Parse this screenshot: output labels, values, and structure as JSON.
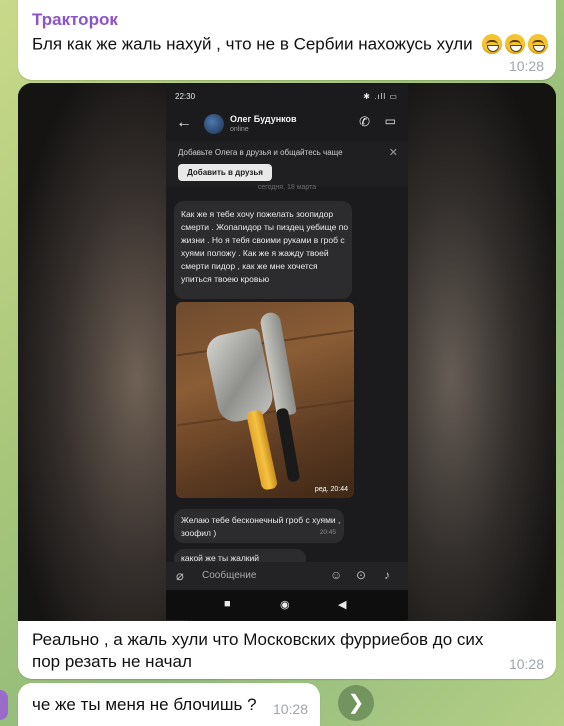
{
  "messages": [
    {
      "sender": "Тракторок",
      "text": "Бля как же жаль нахуй , что не в Сербии нахожусь хули",
      "emojis": [
        "grinning-face",
        "grinning-face",
        "grinning-face"
      ],
      "time": "10:28"
    },
    {
      "type": "screenshot",
      "phone": {
        "status_time": "22:30",
        "status_icons": "✱ .ıll ▭",
        "contact_name": "Олег Будунков",
        "contact_status": "online",
        "banner_text": "Добавьте Олега в друзья и общайтесь чаще",
        "banner_button": "Добавить в друзья",
        "date_divider": "сегодня, 18 марта",
        "bubble1": "Как же я тебе хочу пожелать зоопидор смерти . Жопапидор ты пиздец уебище по жизни . Но я тебя своими руками в гроб с хуями положу . Как же я жажду твоей смерти пидор , как же мне хочется упиться твоею кровью",
        "photo_time": "ред. 20:44",
        "bubble3": "Желаю тебе бесконечный гроб с хуями , зоофил )",
        "bubble3_time": "20:45",
        "bubble4_partial": "какой же ты жалкий",
        "input_placeholder": "Сообщение"
      }
    },
    {
      "text": "Реально , а жаль хули что Московских фурриебов до сих пор резать не начал",
      "time": "10:28"
    },
    {
      "text": "че же ты меня не блочишь ?",
      "time": "10:28"
    }
  ],
  "colors": {
    "sender": "#8b54c9",
    "bubble": "#ffffff",
    "time": "#a0a6ab"
  }
}
